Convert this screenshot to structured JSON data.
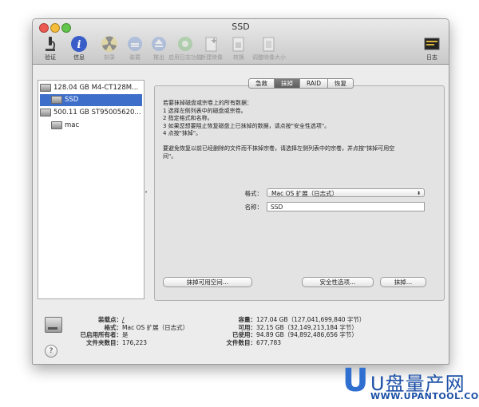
{
  "window": {
    "title": "SSD"
  },
  "toolbar": [
    {
      "name": "verify",
      "label": "验证",
      "enabled": true
    },
    {
      "name": "info",
      "label": "信息",
      "enabled": true
    },
    {
      "name": "burn",
      "label": "刻录",
      "enabled": false
    },
    {
      "name": "mount",
      "label": "装载",
      "enabled": false
    },
    {
      "name": "eject",
      "label": "推出",
      "enabled": false
    },
    {
      "name": "enable-journaling",
      "label": "启用日志功能",
      "enabled": false
    },
    {
      "name": "new-image",
      "label": "新建映像",
      "enabled": false
    },
    {
      "name": "convert",
      "label": "转换",
      "enabled": false
    },
    {
      "name": "resize-image",
      "label": "调整映像大小",
      "enabled": false
    },
    {
      "name": "log",
      "label": "日志",
      "enabled": true
    }
  ],
  "sidebar": {
    "items": [
      {
        "label": "128.04 GB M4-CT128M...",
        "type": "disk"
      },
      {
        "label": "SSD",
        "type": "volume",
        "selected": true
      },
      {
        "label": "500.11 GB ST95005620...",
        "type": "disk"
      },
      {
        "label": "mac",
        "type": "volume"
      }
    ]
  },
  "tabs": [
    {
      "label": "急救",
      "active": false
    },
    {
      "label": "抹掉",
      "active": true
    },
    {
      "label": "RAID",
      "active": false
    },
    {
      "label": "恢复",
      "active": false
    }
  ],
  "erase": {
    "instructions": [
      "若要抹掉磁盘或宗卷上的所有数据：",
      "1 选择左侧列表中的磁盘或宗卷。",
      "2 指定格式和名称。",
      "3 如果您想要阻止恢复磁盘上已抹掉的数据，请点按\"安全性选项\"。",
      "4 点按\"抹掉\"。"
    ],
    "note_line1": "要避免恢复以前已经删除的文件而不抹掉宗卷，请选择左侧列表中的宗卷，并点按\"抹掉可用空",
    "note_line2": "间\"。",
    "format_label": "格式：",
    "format_value": "Mac OS 扩展（日志式）",
    "name_label": "名称：",
    "name_value": "SSD",
    "erase_free_space_button": "抹掉可用空间…",
    "security_options_button": "安全性选项…",
    "erase_button": "抹掉…"
  },
  "info": {
    "left": [
      {
        "key": "装载点：",
        "value": "/",
        "link": true
      },
      {
        "key": "格式：",
        "value": "Mac OS 扩展（日志式）"
      },
      {
        "key": "已启用所有者：",
        "value": "是"
      },
      {
        "key": "文件夹数目：",
        "value": "176,223"
      }
    ],
    "right": [
      {
        "key": "容量：",
        "value": "127.04 GB（127,041,699,840 字节）"
      },
      {
        "key": "可用：",
        "value": "32.15 GB（32,149,213,184 字节）"
      },
      {
        "key": "已使用：",
        "value": "94.89 GB（94,892,486,656 字节）"
      },
      {
        "key": "文件数目：",
        "value": "677,783"
      }
    ],
    "help_label": "?"
  },
  "watermark": {
    "brand": "U盘量产网",
    "url": "WWW.UPANTOOL.COM"
  },
  "colors": {
    "selection": "#3d6ec9",
    "active_tab": "#6a6a6a",
    "link": "#2a55b8",
    "watermark": "#1c4fa6"
  }
}
